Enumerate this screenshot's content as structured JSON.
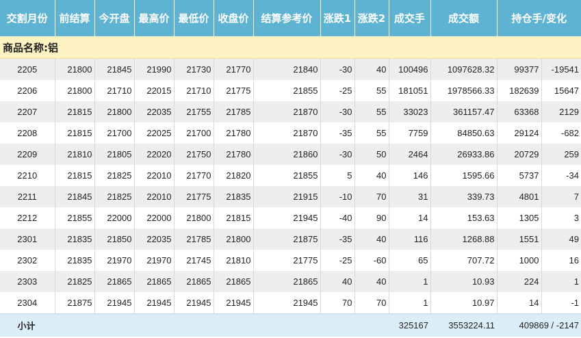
{
  "headers": [
    "交割月份",
    "前结算",
    "今开盘",
    "最高价",
    "最低价",
    "收盘价",
    "结算参考价",
    "涨跌1",
    "涨跌2",
    "成交手",
    "成交额",
    "持仓手/变化"
  ],
  "product_label": "商品名称:铝",
  "rows": [
    [
      "2205",
      "21800",
      "21845",
      "21990",
      "21730",
      "21770",
      "21840",
      "-30",
      "40",
      "100496",
      "1097628.32",
      "99377",
      "-19541"
    ],
    [
      "2206",
      "21800",
      "21710",
      "22015",
      "21710",
      "21775",
      "21855",
      "-25",
      "55",
      "181051",
      "1978566.33",
      "182639",
      "15647"
    ],
    [
      "2207",
      "21815",
      "21800",
      "22035",
      "21755",
      "21785",
      "21870",
      "-30",
      "55",
      "33023",
      "361157.47",
      "63368",
      "2129"
    ],
    [
      "2208",
      "21815",
      "21700",
      "22025",
      "21700",
      "21780",
      "21870",
      "-35",
      "55",
      "7759",
      "84850.63",
      "29124",
      "-682"
    ],
    [
      "2209",
      "21810",
      "21805",
      "22020",
      "21750",
      "21780",
      "21860",
      "-30",
      "50",
      "2464",
      "26933.86",
      "20729",
      "259"
    ],
    [
      "2210",
      "21815",
      "21825",
      "22010",
      "21770",
      "21820",
      "21855",
      "5",
      "40",
      "146",
      "1595.66",
      "5737",
      "-34"
    ],
    [
      "2211",
      "21845",
      "21825",
      "22010",
      "21775",
      "21835",
      "21915",
      "-10",
      "70",
      "31",
      "339.73",
      "4801",
      "7"
    ],
    [
      "2212",
      "21855",
      "22000",
      "22000",
      "21800",
      "21815",
      "21945",
      "-40",
      "90",
      "14",
      "153.63",
      "1305",
      "3"
    ],
    [
      "2301",
      "21835",
      "21850",
      "22035",
      "21785",
      "21800",
      "21875",
      "-35",
      "40",
      "116",
      "1268.88",
      "1551",
      "49"
    ],
    [
      "2302",
      "21835",
      "21970",
      "21970",
      "21745",
      "21810",
      "21775",
      "-25",
      "-60",
      "65",
      "707.72",
      "1000",
      "16"
    ],
    [
      "2303",
      "21825",
      "21865",
      "21865",
      "21865",
      "21865",
      "21865",
      "40",
      "40",
      "1",
      "10.93",
      "224",
      "1"
    ],
    [
      "2304",
      "21875",
      "21945",
      "21945",
      "21945",
      "21945",
      "21945",
      "70",
      "70",
      "1",
      "10.97",
      "14",
      "-1"
    ]
  ],
  "subtotal": {
    "label": "小计",
    "volume": "325167",
    "turnover": "3553224.11",
    "open_interest": "409869 / -2147"
  }
}
